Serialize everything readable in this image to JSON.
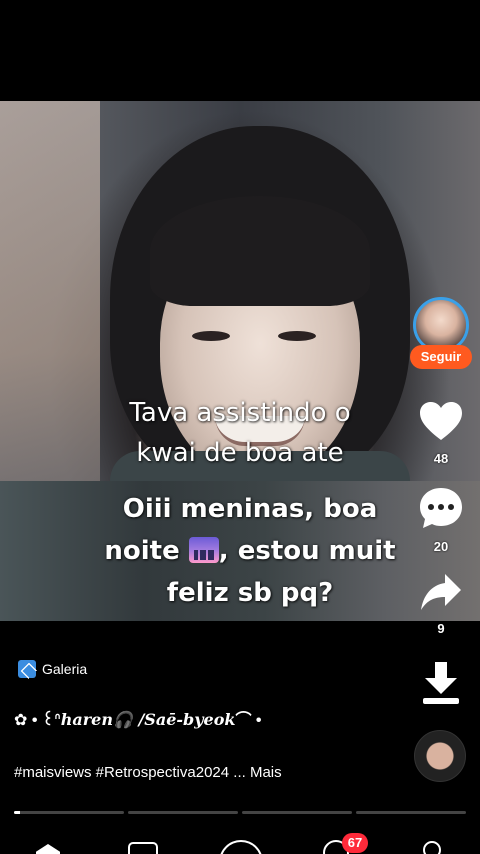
{
  "video": {
    "caption_line1": "Tava assistindo o",
    "caption_line2": "kwai de boa ate",
    "text_line1": "Oiii meninas, boa",
    "text_line2_a": "noite",
    "text_line2_b": ", estou muit",
    "text_line3": "feliz sb pq?",
    "emoji_icon": "night-city-emoji"
  },
  "rail": {
    "follow_label": "Seguir",
    "likes": "48",
    "comments": "20",
    "shares": "9"
  },
  "post": {
    "source_label": "Galeria",
    "author_prefix": "✿ •  ꒰ᐢ",
    "author_name": "haren🎧 /Saē-byeok",
    "author_suffix": "⌒ •",
    "tags": "#maisviews #Retrospectiva2024 ... Mais",
    "progress_fraction": 0.05,
    "progress_segments": 4,
    "active_segment": 1
  },
  "nav": {
    "messages_badge": "67"
  },
  "colors": {
    "follow": "#ff5a1f",
    "badge": "#ff2a3a",
    "avatar_ring": "#3aa0e8",
    "source_icon": "#3b8de0"
  }
}
